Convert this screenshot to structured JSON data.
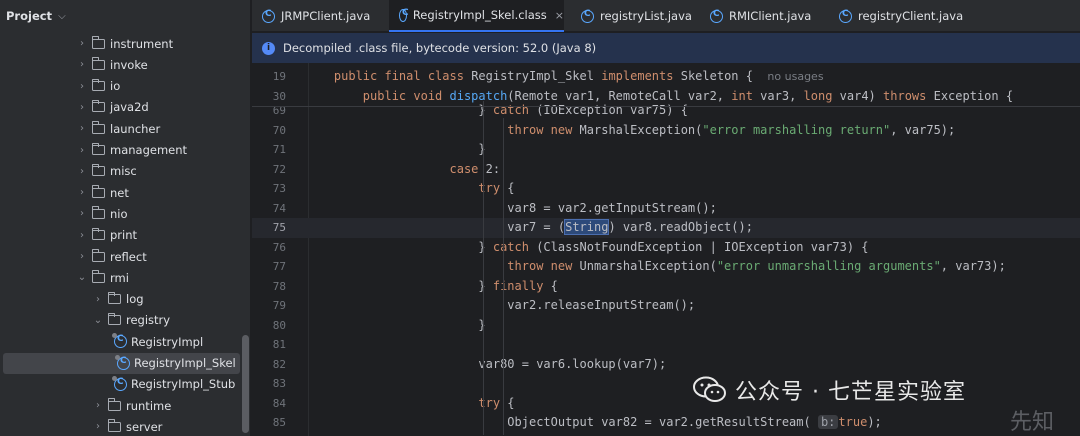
{
  "project": {
    "title": "Project",
    "tree": [
      {
        "label": "instrument",
        "type": "folder",
        "depth": 0,
        "expanded": false
      },
      {
        "label": "invoke",
        "type": "folder",
        "depth": 0,
        "expanded": false
      },
      {
        "label": "io",
        "type": "folder",
        "depth": 0,
        "expanded": false
      },
      {
        "label": "java2d",
        "type": "folder",
        "depth": 0,
        "expanded": false
      },
      {
        "label": "launcher",
        "type": "folder",
        "depth": 0,
        "expanded": false
      },
      {
        "label": "management",
        "type": "folder",
        "depth": 0,
        "expanded": false
      },
      {
        "label": "misc",
        "type": "folder",
        "depth": 0,
        "expanded": false
      },
      {
        "label": "net",
        "type": "folder",
        "depth": 0,
        "expanded": false
      },
      {
        "label": "nio",
        "type": "folder",
        "depth": 0,
        "expanded": false
      },
      {
        "label": "print",
        "type": "folder",
        "depth": 0,
        "expanded": false
      },
      {
        "label": "reflect",
        "type": "folder",
        "depth": 0,
        "expanded": false
      },
      {
        "label": "rmi",
        "type": "folder",
        "depth": 0,
        "expanded": true
      },
      {
        "label": "log",
        "type": "folder",
        "depth": 1,
        "expanded": false
      },
      {
        "label": "registry",
        "type": "folder",
        "depth": 1,
        "expanded": true
      },
      {
        "label": "RegistryImpl",
        "type": "class",
        "depth": 2
      },
      {
        "label": "RegistryImpl_Skel",
        "type": "class",
        "depth": 2,
        "selected": true
      },
      {
        "label": "RegistryImpl_Stub",
        "type": "class",
        "depth": 2
      },
      {
        "label": "runtime",
        "type": "folder",
        "depth": 1,
        "expanded": false
      },
      {
        "label": "server",
        "type": "folder",
        "depth": 1,
        "expanded": false
      }
    ]
  },
  "tabs": [
    {
      "label": "JRMPClient.java",
      "active": false
    },
    {
      "label": "RegistryImpl_Skel.class",
      "active": true
    },
    {
      "label": "registryList.java",
      "active": false
    },
    {
      "label": "RMIClient.java",
      "active": false
    },
    {
      "label": "registryClient.java",
      "active": false
    }
  ],
  "tab_close": "×",
  "banner": {
    "text": "Decompiled .class file, bytecode version: 52.0 (Java 8)"
  },
  "editor": {
    "sticky": [
      {
        "num": "19",
        "tokens": [
          [
            "",
            "    "
          ],
          [
            "kw",
            "public final class "
          ],
          [
            "",
            "RegistryImpl_Skel "
          ],
          [
            "kw",
            "implements "
          ],
          [
            "",
            "Skeleton {  "
          ],
          [
            "hint",
            "no usages"
          ]
        ]
      },
      {
        "num": "30",
        "tokens": [
          [
            "",
            "        "
          ],
          [
            "kw",
            "public void "
          ],
          [
            "fn",
            "dispatch"
          ],
          [
            "",
            "(Remote var1, RemoteCall var2, "
          ],
          [
            "kw",
            "int "
          ],
          [
            "",
            "var3, "
          ],
          [
            "kw",
            "long "
          ],
          [
            "",
            "var4) "
          ],
          [
            "kw",
            "throws "
          ],
          [
            "",
            "Exception {"
          ]
        ]
      }
    ],
    "lines": [
      {
        "num": "69",
        "tokens": [
          [
            "",
            "                        } "
          ],
          [
            "kw",
            "catch "
          ],
          [
            "",
            "(IOException var75) {"
          ]
        ]
      },
      {
        "num": "70",
        "tokens": [
          [
            "",
            "                            "
          ],
          [
            "kw",
            "throw new "
          ],
          [
            "",
            "MarshalException("
          ],
          [
            "str",
            "\"error marshalling return\""
          ],
          [
            "",
            ", var75);"
          ]
        ]
      },
      {
        "num": "71",
        "tokens": [
          [
            "",
            "                        }"
          ]
        ]
      },
      {
        "num": "72",
        "tokens": [
          [
            "",
            "                    "
          ],
          [
            "kw",
            "case "
          ],
          [
            "",
            "2:"
          ]
        ]
      },
      {
        "num": "73",
        "tokens": [
          [
            "",
            "                        "
          ],
          [
            "kw",
            "try "
          ],
          [
            "",
            "{"
          ]
        ]
      },
      {
        "num": "74",
        "tokens": [
          [
            "",
            "                            var8 = var2.getInputStream();"
          ]
        ]
      },
      {
        "num": "75",
        "current": true,
        "tokens": [
          [
            "",
            "                            var7 = ("
          ],
          [
            "hl",
            "String"
          ],
          [
            "",
            ") var8.readObject();"
          ]
        ]
      },
      {
        "num": "76",
        "tokens": [
          [
            "",
            "                        } "
          ],
          [
            "kw",
            "catch "
          ],
          [
            "",
            "(ClassNotFoundException | IOException var73) {"
          ]
        ]
      },
      {
        "num": "77",
        "tokens": [
          [
            "",
            "                            "
          ],
          [
            "kw",
            "throw new "
          ],
          [
            "",
            "UnmarshalException("
          ],
          [
            "str",
            "\"error unmarshalling arguments\""
          ],
          [
            "",
            ", var73);"
          ]
        ]
      },
      {
        "num": "78",
        "tokens": [
          [
            "",
            "                        } "
          ],
          [
            "kw",
            "finally "
          ],
          [
            "",
            "{"
          ]
        ]
      },
      {
        "num": "79",
        "tokens": [
          [
            "",
            "                            var2.releaseInputStream();"
          ]
        ]
      },
      {
        "num": "80",
        "tokens": [
          [
            "",
            "                        }"
          ]
        ]
      },
      {
        "num": "81",
        "tokens": [
          [
            "",
            ""
          ]
        ]
      },
      {
        "num": "82",
        "tokens": [
          [
            "",
            "                        var80 = var6.lookup(var7);"
          ]
        ]
      },
      {
        "num": "83",
        "tokens": [
          [
            "",
            ""
          ]
        ]
      },
      {
        "num": "84",
        "tokens": [
          [
            "",
            "                        "
          ],
          [
            "kw",
            "try "
          ],
          [
            "",
            "{"
          ]
        ]
      },
      {
        "num": "85",
        "tokens": [
          [
            "",
            "                            ObjectOutput var82 = var2.getResultStream( "
          ],
          [
            "pname",
            "b:"
          ],
          [
            "kw",
            "true"
          ],
          [
            "",
            ");"
          ]
        ]
      }
    ]
  },
  "watermark": {
    "text": "公众号 · 七芒星实验室",
    "corner": "先知"
  }
}
